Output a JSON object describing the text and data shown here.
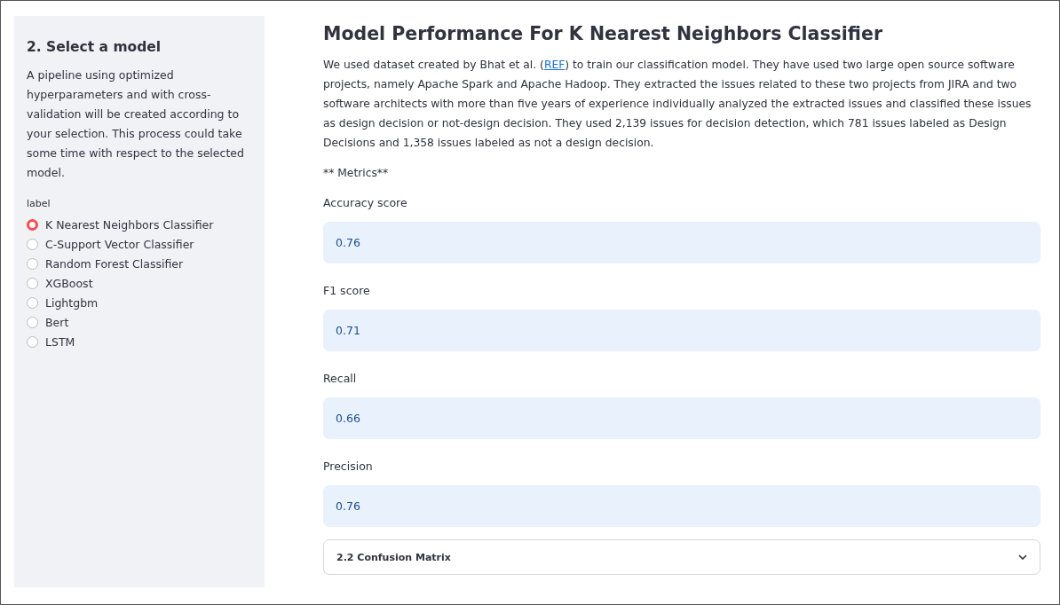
{
  "sidebar": {
    "heading": "2. Select a model",
    "description": "A pipeline using optimized hyperparameters and with cross-validation will be created according to your selection. This process could take some time with respect to the selected model.",
    "radio_label": "label",
    "options": [
      {
        "label": "K Nearest Neighbors Classifier",
        "selected": true
      },
      {
        "label": "C-Support Vector Classifier",
        "selected": false
      },
      {
        "label": "Random Forest Classifier",
        "selected": false
      },
      {
        "label": "XGBoost",
        "selected": false
      },
      {
        "label": "Lightgbm",
        "selected": false
      },
      {
        "label": "Bert",
        "selected": false
      },
      {
        "label": "LSTM",
        "selected": false
      }
    ]
  },
  "main": {
    "title": "Model Performance For K Nearest Neighbors Classifier",
    "intro": {
      "before": "We used dataset created by Bhat et al. (",
      "link": "REF",
      "after": ") to train our classification model. They have used two large open source software projects, namely Apache Spark and Apache Hadoop. They extracted the issues related to these two projects from JIRA and two software architects with more than five years of experience individually analyzed the extracted issues and classified these issues as design decision or not-design decision. They used 2,139 issues for decision detection, which 781 issues labeled as Design Decisions and 1,358 issues labeled as not a design decision."
    },
    "metrics_heading": "** Metrics**",
    "metrics": [
      {
        "label": "Accuracy score",
        "value": "0.76"
      },
      {
        "label": "F1 score",
        "value": "0.71"
      },
      {
        "label": "Recall",
        "value": "0.66"
      },
      {
        "label": "Precision",
        "value": "0.76"
      }
    ],
    "expander": {
      "label": "2.2 Confusion Matrix",
      "expanded": false
    }
  }
}
